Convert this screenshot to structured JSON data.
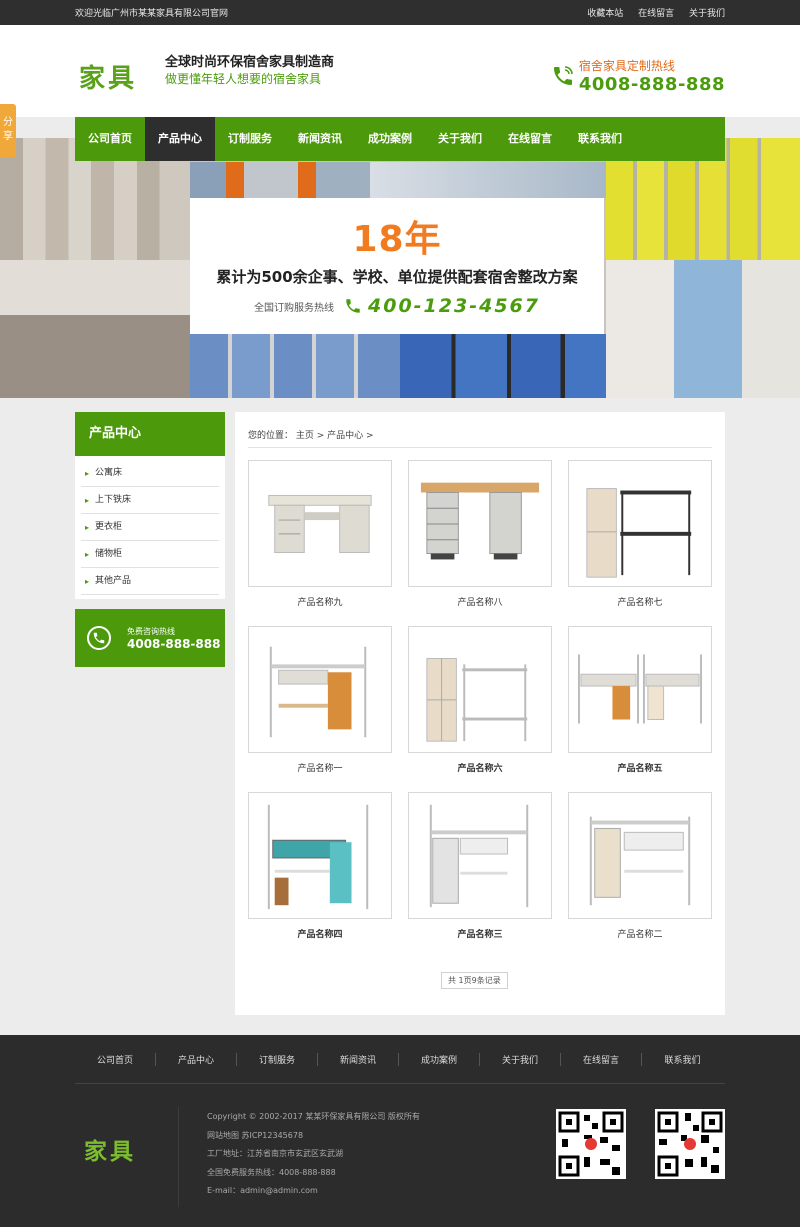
{
  "topbar": {
    "welcome": "欢迎光临广州市某某家具有限公司官网",
    "links": [
      "收藏本站",
      "在线留言",
      "关于我们"
    ]
  },
  "header": {
    "logo": "家具",
    "slogan1": "全球时尚环保宿舍家具制造商",
    "slogan2": "做更懂年轻人想要的宿舍家具",
    "hotline_label": "宿舍家具定制热线",
    "hotline_number": "4008-888-888"
  },
  "nav": [
    "公司首页",
    "产品中心",
    "订制服务",
    "新闻资讯",
    "成功案例",
    "关于我们",
    "在线留言",
    "联系我们"
  ],
  "nav_active": "产品中心",
  "share": [
    "分",
    "享"
  ],
  "banner": {
    "years": "18年",
    "headline": "累计为500余企事、学校、单位提供配套宿舍整改方案",
    "hotline_label": "全国订购服务热线",
    "hotline_number": "400-123-4567"
  },
  "sidebar": {
    "title": "产品中心",
    "items": [
      "公寓床",
      "上下铁床",
      "更衣柜",
      "储物柜",
      "其他产品"
    ],
    "contact_label": "免费咨询热线",
    "contact_number": "4008-888-888"
  },
  "breadcrumb": "您的位置： 主页 > 产品中心 >",
  "products": [
    {
      "name": "产品名称九",
      "bold": false
    },
    {
      "name": "产品名称八",
      "bold": false
    },
    {
      "name": "产品名称七",
      "bold": false
    },
    {
      "name": "产品名称一",
      "bold": false
    },
    {
      "name": "产品名称六",
      "bold": true
    },
    {
      "name": "产品名称五",
      "bold": true
    },
    {
      "name": "产品名称四",
      "bold": true
    },
    {
      "name": "产品名称三",
      "bold": true
    },
    {
      "name": "产品名称二",
      "bold": false
    }
  ],
  "pager": "共 1页9条记录",
  "footer": {
    "nav": [
      "公司首页",
      "产品中心",
      "订制服务",
      "新闻资讯",
      "成功案例",
      "关于我们",
      "在线留言",
      "联系我们"
    ],
    "logo": "家具",
    "info": [
      "Copyright © 2002-2017 某某环保家具有限公司 版权所有",
      "网站地图   苏ICP12345678",
      "工厂地址：江苏省南京市玄武区玄武湖",
      "全国免费服务热线：4008-888-888",
      "E-mail：admin@admin.com"
    ]
  },
  "colors": {
    "green": "#4c9a0b",
    "orange": "#f17b20",
    "dark": "#2e2e2e"
  }
}
